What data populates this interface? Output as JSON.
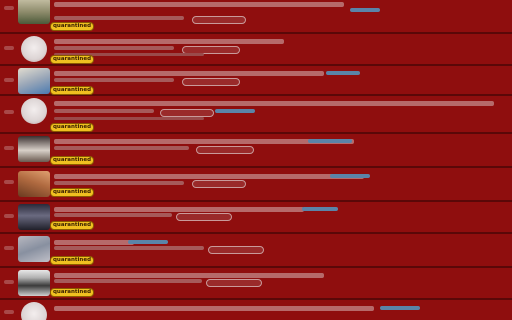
{
  "feed": {
    "badge_label": "quarantined",
    "rows": [
      {
        "thumb": "img-a",
        "has_badge": true
      },
      {
        "thumb": "circle",
        "has_badge": true
      },
      {
        "thumb": "img-b",
        "has_badge": true
      },
      {
        "thumb": "circle",
        "has_badge": true
      },
      {
        "thumb": "img-c",
        "has_badge": true
      },
      {
        "thumb": "img-d",
        "has_badge": true
      },
      {
        "thumb": "img-e",
        "has_badge": true
      },
      {
        "thumb": "img-f",
        "has_badge": true
      },
      {
        "thumb": "img-g",
        "has_badge": true
      },
      {
        "thumb": "circle",
        "has_badge": false
      }
    ]
  },
  "colors": {
    "row_background": "#8f0e0e",
    "badge_background": "#f0c020",
    "divider": "#5a0808"
  }
}
